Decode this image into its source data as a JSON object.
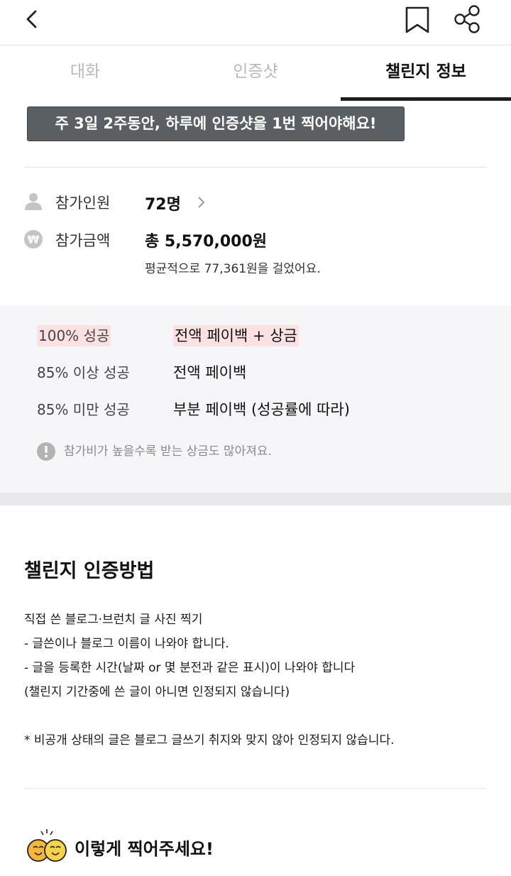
{
  "header": {
    "back_icon": "chevron-left-icon",
    "bookmark_icon": "bookmark-icon",
    "share_icon": "share-icon"
  },
  "tabs": [
    {
      "label": "대화"
    },
    {
      "label": "인증샷"
    },
    {
      "label": "챌린지 정보"
    }
  ],
  "banner": {
    "text": "주 3일 2주동안, 하루에 인증샷을 1번 찍어야해요!"
  },
  "participants": {
    "icon": "person-icon",
    "label": "참가인원",
    "value": "72명"
  },
  "amount": {
    "icon": "won-icon",
    "label": "참가금액",
    "value": "총 5,570,000원",
    "sub": "평균적으로 77,361원을 걸었어요."
  },
  "payback": {
    "rows": [
      {
        "condition": "100% 성공",
        "reward": "전액 페이백 + 상금"
      },
      {
        "condition": "85% 이상 성공",
        "reward": "전액 페이백"
      },
      {
        "condition": "85% 미만 성공",
        "reward": "부분 페이백 (성공률에 따라)"
      }
    ],
    "note_icon": "exclamation-icon",
    "note": "참가비가 높을수록 받는 상금도 많아져요."
  },
  "method": {
    "title": "챌린지 인증방법",
    "lines": [
      "직접 쓴 블로그·브런치 글 사진 찍기",
      "- 글쓴이나 블로그 이름이 나와야 합니다.",
      "- 글을 등록한 시간(날짜 or 몇 분전과 같은 표시)이 나와야 합니다",
      "(챌린지 기간중에 쓴 글이 아니면 인정되지 않습니다)",
      "* 비공개 상태의 글은 블로그 글쓰기 취지와 맞지 않아 인정되지 않습니다."
    ]
  },
  "cheer": {
    "icon": "smiling-faces-icon",
    "title": "이렇게 찍어주세요!"
  },
  "colors": {
    "banner_bg": "#5a5f64",
    "highlight": "#fbe1e3",
    "panel_bg": "#f6f6f8",
    "active_tab": "#1e1e1e"
  }
}
